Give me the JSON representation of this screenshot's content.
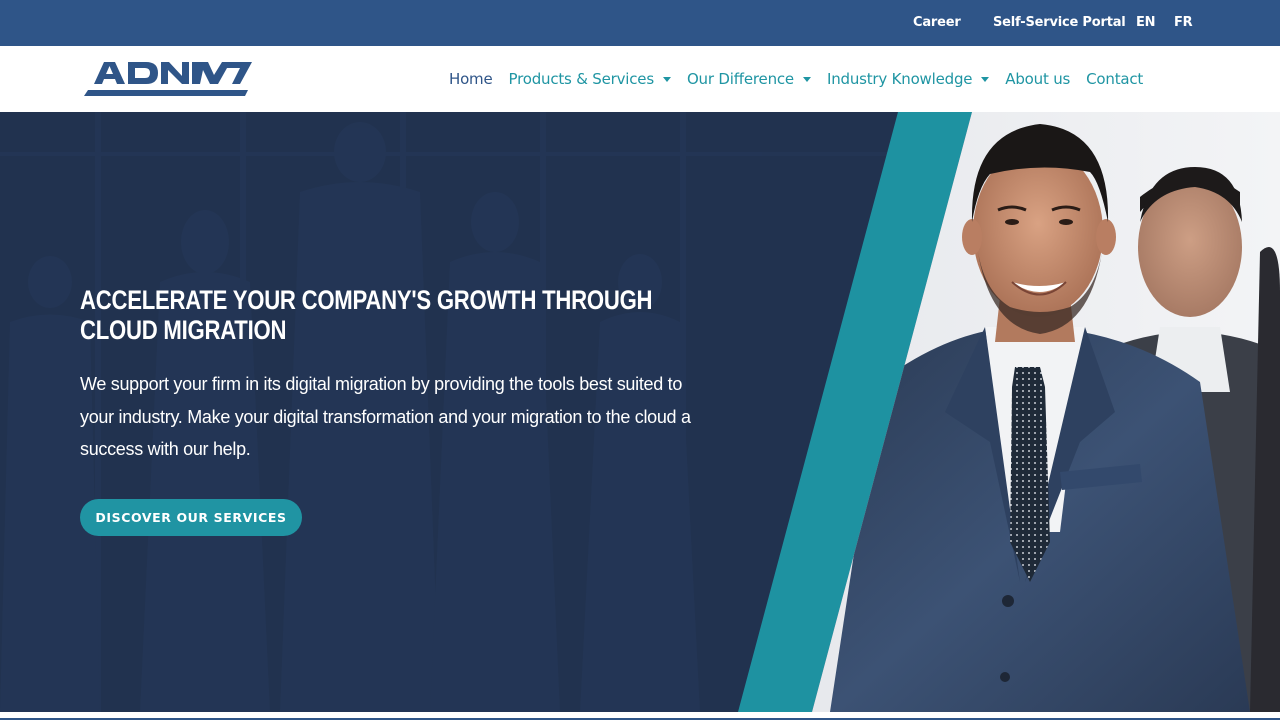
{
  "topbar": {
    "links": [
      {
        "label": "Career"
      },
      {
        "label": "Self-Service Portal"
      },
      {
        "label": "EN"
      },
      {
        "label": "FR"
      }
    ]
  },
  "brand": {
    "logo_text": "ADNM",
    "primary_color": "#2f5588",
    "accent_color": "#1f95a3"
  },
  "nav": {
    "items": [
      {
        "label": "Home",
        "active": true,
        "dropdown": false
      },
      {
        "label": "Products & Services",
        "active": false,
        "dropdown": true
      },
      {
        "label": "Our Difference",
        "active": false,
        "dropdown": true
      },
      {
        "label": "Industry Knowledge",
        "active": false,
        "dropdown": true
      },
      {
        "label": "About us",
        "active": false,
        "dropdown": false
      },
      {
        "label": "Contact",
        "active": false,
        "dropdown": false
      }
    ]
  },
  "hero": {
    "title": "Accelerate your company's growth through cloud migration",
    "text": "We support your firm in its digital migration by providing the tools best suited to your industry. Make your digital transformation and your migration to the cloud a success with our help.",
    "cta_label": "DISCOVER OUR SERVICES",
    "image_description": "smiling businessman in navy suit with colleagues in background"
  }
}
